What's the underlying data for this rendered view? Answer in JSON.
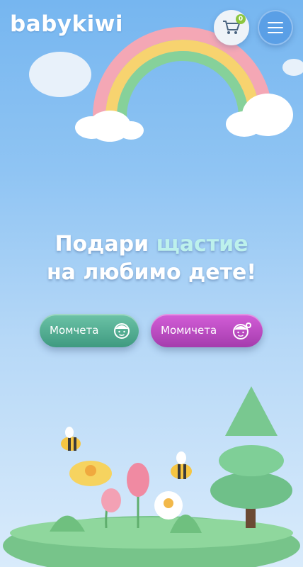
{
  "header": {
    "logo_text": "babykiwi",
    "cart_count": "0",
    "cart_icon": "cart-icon",
    "menu_icon": "hamburger-icon"
  },
  "hero": {
    "line1_part1": "Подари ",
    "line1_accent": "щастие",
    "line2": "на любимо дете!"
  },
  "buttons": {
    "boys_label": "Момчета",
    "girls_label": "Момичета"
  },
  "colors": {
    "sky_top": "#76b6f0",
    "accent_teal": "#bdf1ec",
    "boys_button": "#4fae91",
    "girls_button": "#c04cc6",
    "cart_badge": "#8cc63f"
  }
}
